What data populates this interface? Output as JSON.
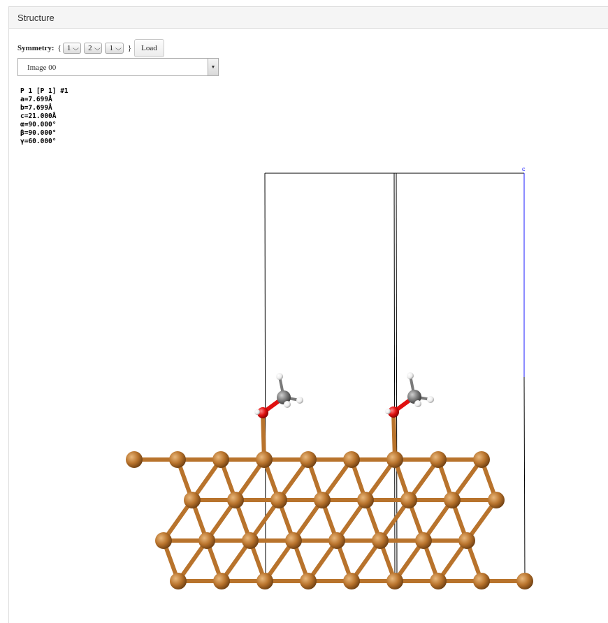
{
  "panel": {
    "title": "Structure"
  },
  "symmetry": {
    "label": "Symmetry:",
    "open_brace": "{",
    "close_brace": "}",
    "values": [
      "1",
      "2",
      "1"
    ],
    "load_label": "Load"
  },
  "image_select": {
    "selected": "Image 00"
  },
  "cell": {
    "line1": "P 1 [P 1] #1",
    "a": "a=7.699Å",
    "b": "b=7.699Å",
    "c": "c=21.000Å",
    "alpha": "α=90.000°",
    "beta": "β=90.000°",
    "gamma": "γ=60.000°"
  },
  "viewer": {
    "axis_label": "c",
    "colors": {
      "substrate": "#b8732c",
      "oxygen": "#e01010",
      "carbon": "#7a7a7a",
      "hydrogen": "#f2f2f2",
      "cell_edge": "#000000",
      "c_axis": "#1a1aff"
    }
  }
}
